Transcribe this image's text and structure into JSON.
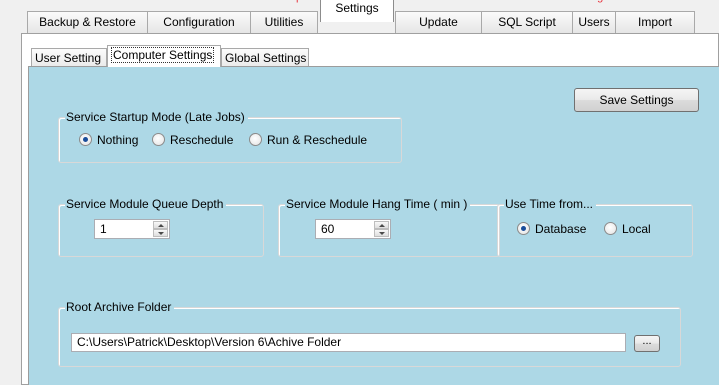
{
  "header": {
    "red_text_left": "p",
    "red_text_right": "ngnn"
  },
  "main_tabs": [
    {
      "label": "Backup & Restore"
    },
    {
      "label": "Configuration"
    },
    {
      "label": "Utilities"
    },
    {
      "label": "Settings"
    },
    {
      "label": "Update"
    },
    {
      "label": "SQL Script"
    },
    {
      "label": "Users"
    },
    {
      "label": "Import"
    }
  ],
  "active_main_tab": "Settings",
  "sub_tabs": [
    {
      "label": "User Setting"
    },
    {
      "label": "Computer Settings"
    },
    {
      "label": "Global Settings"
    }
  ],
  "active_sub_tab": "Computer Settings",
  "colors": {
    "panel_background": "#add8e6",
    "radio_dot": "#1a4d9a"
  },
  "startup_mode": {
    "legend": "Service Startup Mode (Late Jobs)",
    "options": [
      {
        "label": "Nothing",
        "checked": true
      },
      {
        "label": "Reschedule",
        "checked": false
      },
      {
        "label": "Run & Reschedule",
        "checked": false
      }
    ]
  },
  "save_button": {
    "label": "Save Settings"
  },
  "queue_depth": {
    "legend": "Service Module Queue Depth",
    "value": "1"
  },
  "hang_time": {
    "legend": "Service Module Hang Time ( min )",
    "value": "60"
  },
  "use_time_from": {
    "legend": "Use Time from...",
    "options": [
      {
        "label": "Database",
        "checked": true
      },
      {
        "label": "Local",
        "checked": false
      }
    ]
  },
  "root_archive": {
    "legend": "Root Archive Folder",
    "path": "C:\\Users\\Patrick\\Desktop\\Version 6\\Achive Folder",
    "browse_label": "..."
  }
}
